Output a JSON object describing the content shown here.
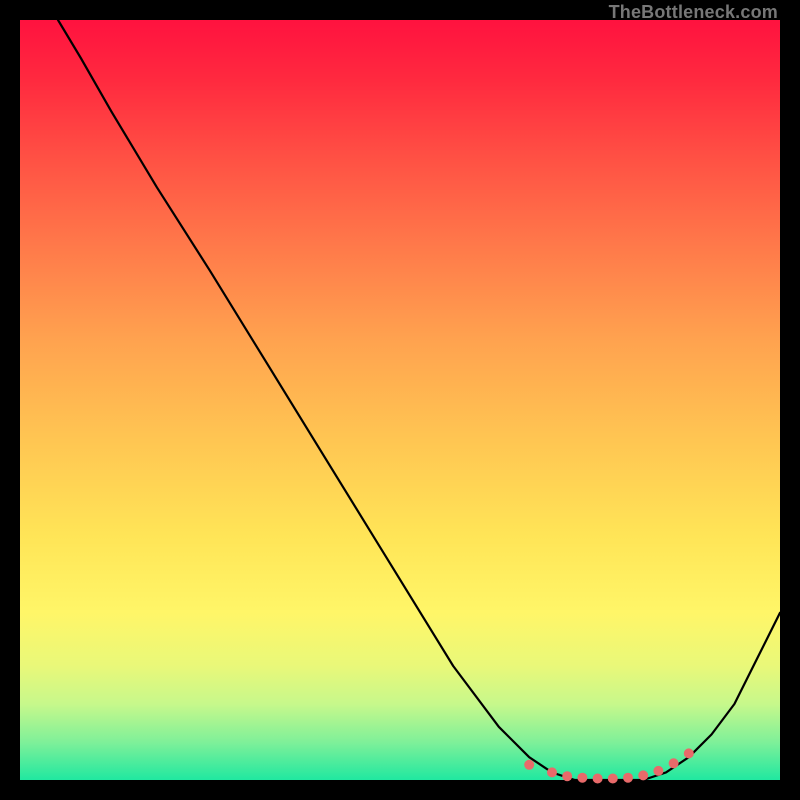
{
  "attribution": "TheBottleneck.com",
  "chart_data": {
    "type": "line",
    "title": "",
    "xlabel": "",
    "ylabel": "",
    "xlim": [
      0,
      100
    ],
    "ylim": [
      0,
      100
    ],
    "series": [
      {
        "name": "bottleneck-curve",
        "x": [
          5,
          8,
          12,
          18,
          25,
          33,
          41,
          49,
          57,
          63,
          67,
          70,
          73,
          76,
          79,
          82,
          85,
          88,
          91,
          94,
          97,
          100
        ],
        "y": [
          100,
          95,
          88,
          78,
          67,
          54,
          41,
          28,
          15,
          7,
          3,
          1,
          0,
          0,
          0,
          0,
          1,
          3,
          6,
          10,
          16,
          22
        ]
      }
    ],
    "markers": {
      "name": "flat-region-dots",
      "x": [
        67,
        70,
        72,
        74,
        76,
        78,
        80,
        82,
        84,
        86,
        88
      ],
      "y": [
        2,
        1,
        0.5,
        0.3,
        0.2,
        0.2,
        0.3,
        0.6,
        1.2,
        2.2,
        3.5
      ]
    },
    "colors": {
      "curve": "#000000",
      "markers": "#e86a6a",
      "background_top": "#ff123f",
      "background_bottom": "#20e8a0"
    }
  }
}
